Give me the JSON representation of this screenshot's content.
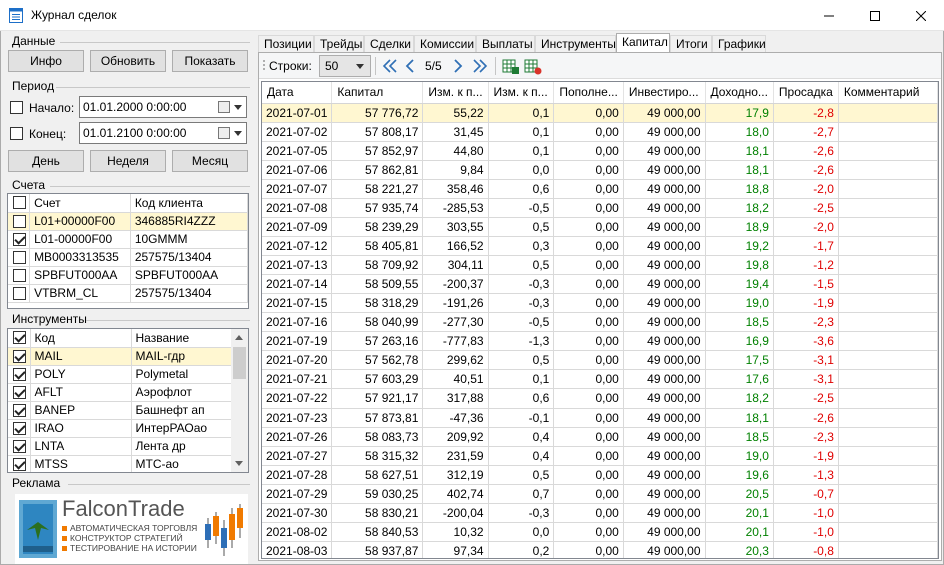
{
  "window": {
    "title": "Журнал сделок",
    "accent": "#1d6fc8"
  },
  "left": {
    "data_group": {
      "label": "Данные",
      "info_button": "Инфо",
      "refresh_button": "Обновить",
      "show_button": "Показать"
    },
    "period": {
      "label": "Период",
      "start_label": "Начало:",
      "start_value": "01.01.2000  0:00:00",
      "start_checked": false,
      "end_label": "Конец:",
      "end_value": "01.01.2100  0:00:00",
      "end_checked": false,
      "day_button": "День",
      "week_button": "Неделя",
      "month_button": "Месяц"
    },
    "accounts": {
      "label": "Счета",
      "columns": [
        "Счет",
        "Код клиента"
      ],
      "rows": [
        {
          "checked": false,
          "account": "L01+00000F00",
          "client": "346885RI4ZZZ",
          "selected": true
        },
        {
          "checked": true,
          "account": "L01-00000F00",
          "client": "10GMMM",
          "selected": false
        },
        {
          "checked": false,
          "account": "MB0003313535",
          "client": "257575/13404",
          "selected": false
        },
        {
          "checked": false,
          "account": "SPBFUT000AA",
          "client": "SPBFUT000AA",
          "selected": false
        },
        {
          "checked": false,
          "account": "VTBRM_CL",
          "client": "257575/13404",
          "selected": false
        }
      ]
    },
    "instruments": {
      "label": "Инструменты",
      "columns": [
        "Код",
        "Название"
      ],
      "rows": [
        {
          "checked": true,
          "code": "MAIL",
          "name": "MAIL-гдр",
          "selected": true
        },
        {
          "checked": true,
          "code": "POLY",
          "name": "Polymetal",
          "selected": false
        },
        {
          "checked": true,
          "code": "AFLT",
          "name": "Аэрофлот",
          "selected": false
        },
        {
          "checked": true,
          "code": "BANEP",
          "name": "Башнефт ап",
          "selected": false
        },
        {
          "checked": true,
          "code": "IRAO",
          "name": "ИнтерРАОао",
          "selected": false
        },
        {
          "checked": true,
          "code": "LNTA",
          "name": "Лента др",
          "selected": false
        },
        {
          "checked": true,
          "code": "MTSS",
          "name": "МТС-ао",
          "selected": false
        }
      ]
    },
    "ad": {
      "label": "Реклама",
      "brand": "FalconTrade",
      "lines": [
        "АВТОМАТИЧЕСКАЯ ТОРГОВЛЯ",
        "КОНСТРУКТОР СТРАТЕГИЙ",
        "ТЕСТИРОВАНИЕ НА ИСТОРИИ"
      ],
      "bullet_color": "#f07a00"
    }
  },
  "tabs": {
    "items": [
      "Позиции",
      "Трейды",
      "Сделки",
      "Комиссии",
      "Выплаты",
      "Инструменты",
      "Капитал",
      "Итоги",
      "Графики"
    ],
    "active": "Капитал"
  },
  "toolbar": {
    "rows_label": "Строки:",
    "rows_value": "50",
    "page_indicator": "5/5"
  },
  "grid": {
    "columns": [
      "Дата",
      "Капитал",
      "Изм. к п...",
      "Изм. к п...",
      "Пополне...",
      "Инвестиро...",
      "Доходно...",
      "Просадка",
      "Комментарий"
    ],
    "rows": [
      [
        "2021-07-01",
        "57 776,72",
        "55,22",
        "0,1",
        "0,00",
        "49 000,00",
        "17,9",
        "-2,8",
        ""
      ],
      [
        "2021-07-02",
        "57 808,17",
        "31,45",
        "0,1",
        "0,00",
        "49 000,00",
        "18,0",
        "-2,7",
        ""
      ],
      [
        "2021-07-05",
        "57 852,97",
        "44,80",
        "0,1",
        "0,00",
        "49 000,00",
        "18,1",
        "-2,6",
        ""
      ],
      [
        "2021-07-06",
        "57 862,81",
        "9,84",
        "0,0",
        "0,00",
        "49 000,00",
        "18,1",
        "-2,6",
        ""
      ],
      [
        "2021-07-07",
        "58 221,27",
        "358,46",
        "0,6",
        "0,00",
        "49 000,00",
        "18,8",
        "-2,0",
        ""
      ],
      [
        "2021-07-08",
        "57 935,74",
        "-285,53",
        "-0,5",
        "0,00",
        "49 000,00",
        "18,2",
        "-2,5",
        ""
      ],
      [
        "2021-07-09",
        "58 239,29",
        "303,55",
        "0,5",
        "0,00",
        "49 000,00",
        "18,9",
        "-2,0",
        ""
      ],
      [
        "2021-07-12",
        "58 405,81",
        "166,52",
        "0,3",
        "0,00",
        "49 000,00",
        "19,2",
        "-1,7",
        ""
      ],
      [
        "2021-07-13",
        "58 709,92",
        "304,11",
        "0,5",
        "0,00",
        "49 000,00",
        "19,8",
        "-1,2",
        ""
      ],
      [
        "2021-07-14",
        "58 509,55",
        "-200,37",
        "-0,3",
        "0,00",
        "49 000,00",
        "19,4",
        "-1,5",
        ""
      ],
      [
        "2021-07-15",
        "58 318,29",
        "-191,26",
        "-0,3",
        "0,00",
        "49 000,00",
        "19,0",
        "-1,9",
        ""
      ],
      [
        "2021-07-16",
        "58 040,99",
        "-277,30",
        "-0,5",
        "0,00",
        "49 000,00",
        "18,5",
        "-2,3",
        ""
      ],
      [
        "2021-07-19",
        "57 263,16",
        "-777,83",
        "-1,3",
        "0,00",
        "49 000,00",
        "16,9",
        "-3,6",
        ""
      ],
      [
        "2021-07-20",
        "57 562,78",
        "299,62",
        "0,5",
        "0,00",
        "49 000,00",
        "17,5",
        "-3,1",
        ""
      ],
      [
        "2021-07-21",
        "57 603,29",
        "40,51",
        "0,1",
        "0,00",
        "49 000,00",
        "17,6",
        "-3,1",
        ""
      ],
      [
        "2021-07-22",
        "57 921,17",
        "317,88",
        "0,6",
        "0,00",
        "49 000,00",
        "18,2",
        "-2,5",
        ""
      ],
      [
        "2021-07-23",
        "57 873,81",
        "-47,36",
        "-0,1",
        "0,00",
        "49 000,00",
        "18,1",
        "-2,6",
        ""
      ],
      [
        "2021-07-26",
        "58 083,73",
        "209,92",
        "0,4",
        "0,00",
        "49 000,00",
        "18,5",
        "-2,3",
        ""
      ],
      [
        "2021-07-27",
        "58 315,32",
        "231,59",
        "0,4",
        "0,00",
        "49 000,00",
        "19,0",
        "-1,9",
        ""
      ],
      [
        "2021-07-28",
        "58 627,51",
        "312,19",
        "0,5",
        "0,00",
        "49 000,00",
        "19,6",
        "-1,3",
        ""
      ],
      [
        "2021-07-29",
        "59 030,25",
        "402,74",
        "0,7",
        "0,00",
        "49 000,00",
        "20,5",
        "-0,7",
        ""
      ],
      [
        "2021-07-30",
        "58 830,21",
        "-200,04",
        "-0,3",
        "0,00",
        "49 000,00",
        "20,1",
        "-1,0",
        ""
      ],
      [
        "2021-08-02",
        "58 840,53",
        "10,32",
        "0,0",
        "0,00",
        "49 000,00",
        "20,1",
        "-1,0",
        ""
      ],
      [
        "2021-08-03",
        "58 937,87",
        "97,34",
        "0,2",
        "0,00",
        "49 000,00",
        "20,3",
        "-0,8",
        ""
      ]
    ],
    "selected_row": 0,
    "positive_color": "#008000",
    "negative_color": "#e00000"
  }
}
